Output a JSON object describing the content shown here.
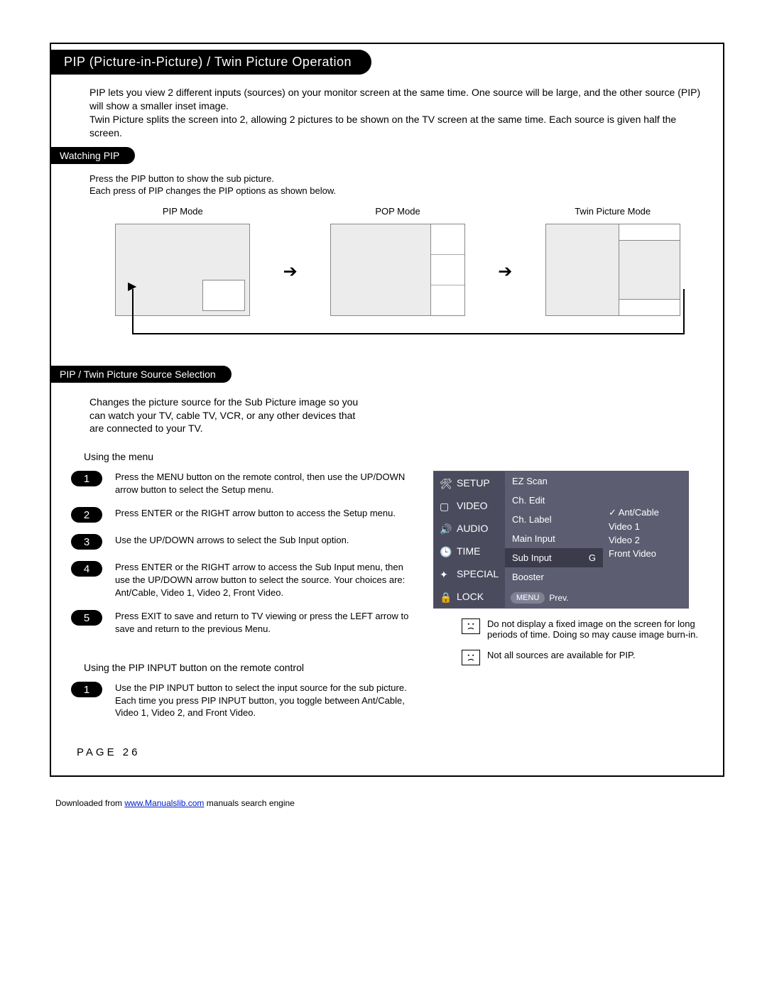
{
  "title": "PIP (Picture-in-Picture) / Twin Picture Operation",
  "intro_p1": "PIP lets you view 2 different inputs (sources) on your monitor screen at the same time. One source will be large, and the other source (PIP) will show a smaller inset image.",
  "intro_p2": "Twin Picture splits the screen into 2, allowing 2 pictures to be shown on the TV screen at the same time. Each source is given half the screen.",
  "watching_pip_heading": "Watching PIP",
  "watching_pip_l1": "Press the PIP button to show the sub picture.",
  "watching_pip_l2": "Each press of PIP changes the PIP options as shown below.",
  "modes": {
    "pip": "PIP Mode",
    "pop": "POP Mode",
    "twin": "Twin Picture Mode"
  },
  "source_sel_heading": "PIP / Twin Picture Source Selection",
  "source_sel_desc": "Changes the picture source for the Sub Picture image so you can watch your TV, cable TV, VCR, or any other devices that are connected to your TV.",
  "using_menu_heading": "Using the menu",
  "steps_menu": {
    "s1": "Press the MENU button on the remote control, then use the UP/DOWN arrow button to select the Setup menu.",
    "s2": "Press ENTER or the RIGHT arrow button to access the Setup menu.",
    "s3": "Use the UP/DOWN arrows to select the Sub Input option.",
    "s4": "Press ENTER or the RIGHT arrow to access the Sub Input menu, then use the UP/DOWN arrow button to select the source. Your choices are: Ant/Cable, Video 1, Video 2, Front Video.",
    "s5": "Press EXIT to save and return to TV viewing or press the LEFT arrow to save and return to the previous Menu."
  },
  "using_pip_input_heading": "Using the PIP INPUT button on the remote control",
  "steps_pipinput": {
    "s1": "Use the PIP INPUT button to select the input source for the sub picture.\nEach time you press PIP INPUT button, you toggle between Ant/Cable, Video 1, Video 2, and Front Video."
  },
  "osd": {
    "left": [
      "SETUP",
      "VIDEO",
      "AUDIO",
      "TIME",
      "SPECIAL",
      "LOCK"
    ],
    "mid": {
      "items": [
        "EZ Scan",
        "Ch. Edit",
        "Ch. Label",
        "Main Input",
        "Sub Input",
        "Booster"
      ],
      "selected": "Sub Input",
      "glyph": "G",
      "footer_btn": "MENU",
      "footer_txt": "Prev."
    },
    "right": {
      "options": [
        "Ant/Cable",
        "Video 1",
        "Video 2",
        "Front Video"
      ],
      "selected": "Ant/Cable"
    }
  },
  "warnings": {
    "w1": "Do not display a fixed image on the screen for long periods of  time. Doing so may cause image burn-in.",
    "w2": "Not all sources are available for PIP."
  },
  "page_label": "PAGE 26",
  "download": {
    "prefix": "Downloaded from ",
    "link": "www.Manualslib.com",
    "suffix": " manuals search engine"
  }
}
